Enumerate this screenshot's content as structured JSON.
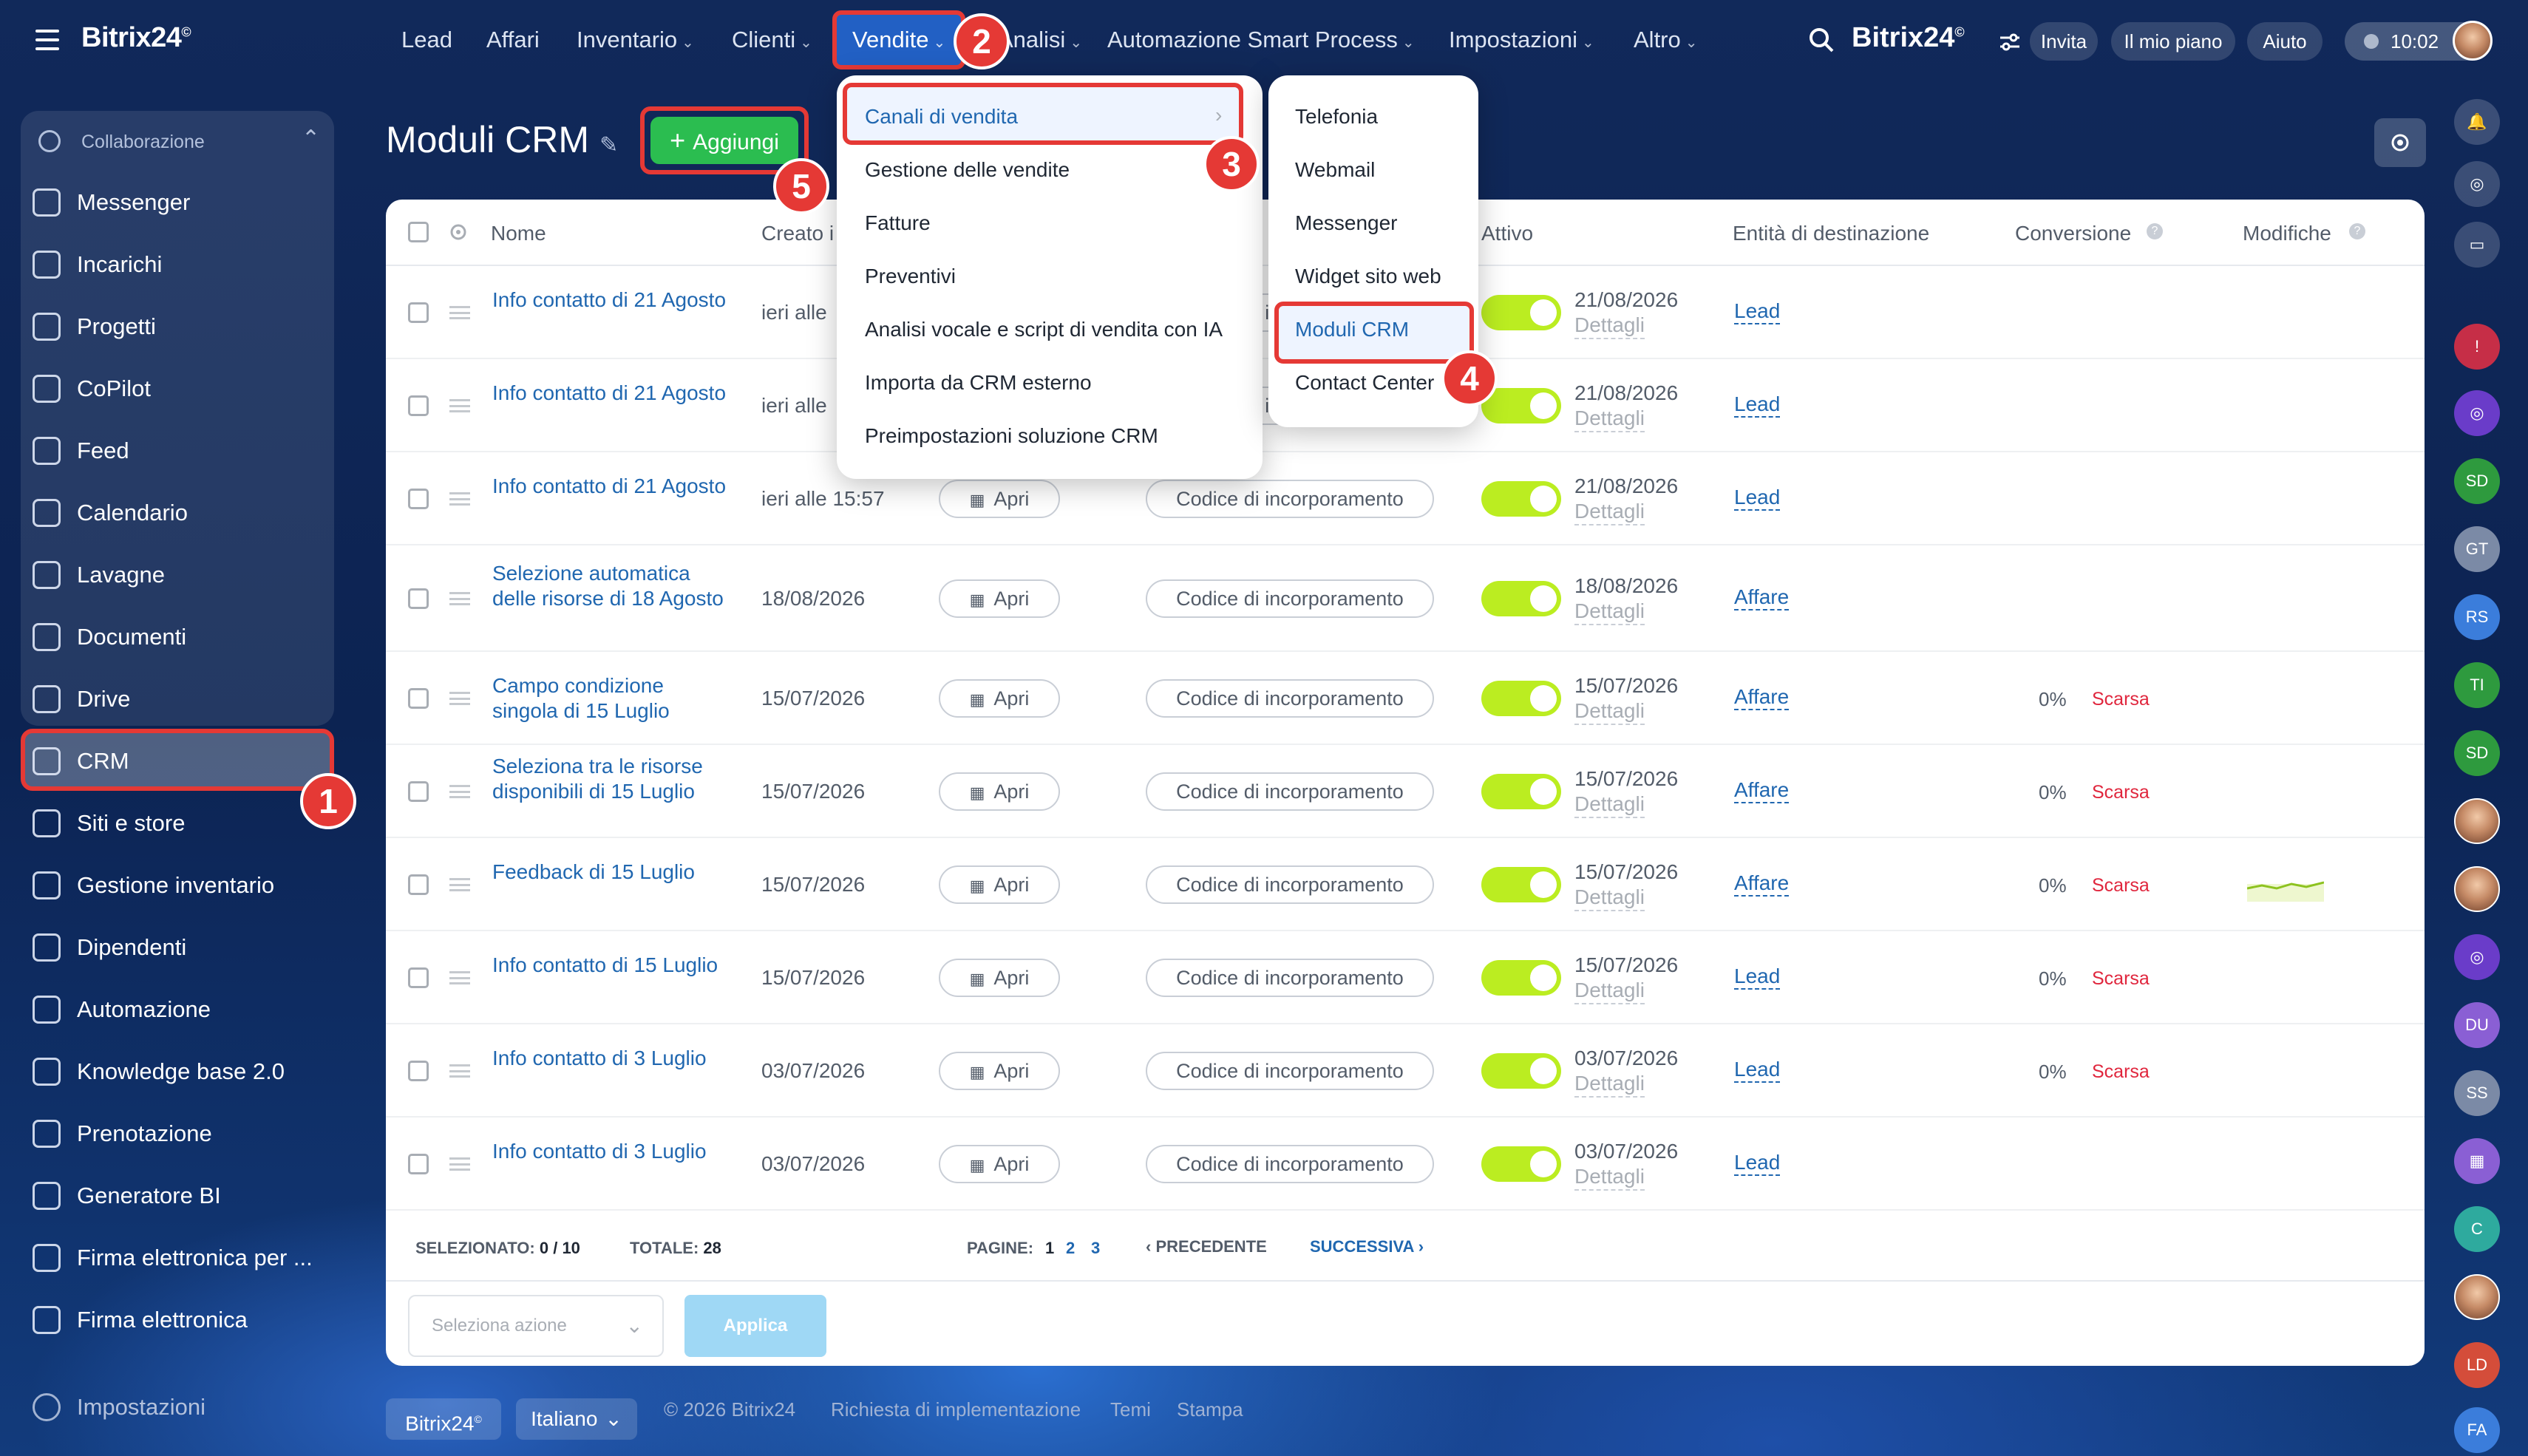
{
  "app": {
    "logo": "Bitrix24",
    "logo_mark": "©",
    "time": "10:02"
  },
  "topnav": {
    "items": [
      "Lead",
      "Affari",
      "Inventario",
      "Clienti",
      "Vendite",
      "Analisi",
      "Automazione Smart Process",
      "Impostazioni",
      "Altro"
    ],
    "active": "Vendite",
    "right": {
      "logo": "Bitrix24",
      "invite": "Invita",
      "plan": "Il mio piano",
      "help": "Aiuto"
    }
  },
  "sidebar": {
    "section": "Collaborazione",
    "items": [
      "Messenger",
      "Incarichi",
      "Progetti",
      "CoPilot",
      "Feed",
      "Calendario",
      "Lavagne",
      "Documenti",
      "Drive",
      "CRM",
      "Siti e store",
      "Gestione inventario",
      "Dipendenti",
      "Automazione",
      "Knowledge base 2.0",
      "Prenotazione",
      "Generatore BI",
      "Firma elettronica per ...",
      "Firma elettronica"
    ],
    "active": "CRM",
    "settings": "Impostazioni"
  },
  "page": {
    "title": "Moduli CRM",
    "add_label": "Aggiungi"
  },
  "table": {
    "headers": {
      "name": "Nome",
      "created": "Creato i",
      "active": "Attivo",
      "entity": "Entità di destinazione",
      "conversion": "Conversione",
      "changes": "Modifiche"
    },
    "open_label": "Apri",
    "embed_label": "Codice di incorporamento",
    "details_label": "Dettagli",
    "rows": [
      {
        "name": "Info contatto di 21 Agosto",
        "created": "ieri alle",
        "date": "21/08/2026",
        "entity": "Lead",
        "conv": "",
        "rating": ""
      },
      {
        "name": "Info contatto di 21 Agosto",
        "created": "ieri alle",
        "date": "21/08/2026",
        "entity": "Lead",
        "conv": "",
        "rating": ""
      },
      {
        "name": "Info contatto di 21 Agosto",
        "created": "ieri alle 15:57",
        "date": "21/08/2026",
        "entity": "Lead",
        "conv": "",
        "rating": ""
      },
      {
        "name": "Selezione automatica delle risorse di 18 Agosto",
        "created": "18/08/2026",
        "date": "18/08/2026",
        "entity": "Affare",
        "conv": "",
        "rating": ""
      },
      {
        "name": "Campo condizione singola di 15 Luglio",
        "created": "15/07/2026",
        "date": "15/07/2026",
        "entity": "Affare",
        "conv": "0%",
        "rating": "Scarsa"
      },
      {
        "name": "Seleziona tra le risorse disponibili di 15 Luglio",
        "created": "15/07/2026",
        "date": "15/07/2026",
        "entity": "Affare",
        "conv": "0%",
        "rating": "Scarsa"
      },
      {
        "name": "Feedback di 15 Luglio",
        "created": "15/07/2026",
        "date": "15/07/2026",
        "entity": "Affare",
        "conv": "0%",
        "rating": "Scarsa"
      },
      {
        "name": "Info contatto di 15 Luglio",
        "created": "15/07/2026",
        "date": "15/07/2026",
        "entity": "Lead",
        "conv": "0%",
        "rating": "Scarsa"
      },
      {
        "name": "Info contatto di 3 Luglio",
        "created": "03/07/2026",
        "date": "03/07/2026",
        "entity": "Lead",
        "conv": "0%",
        "rating": "Scarsa"
      },
      {
        "name": "Info contatto di 3 Luglio",
        "created": "03/07/2026",
        "date": "03/07/2026",
        "entity": "Lead",
        "conv": "",
        "rating": ""
      }
    ],
    "footer": {
      "selected_label": "Selezionato:",
      "selected": "0 / 10",
      "total_label": "Totale:",
      "total": "28",
      "pages_label": "Pagine:",
      "pages": [
        "1",
        "2",
        "3"
      ],
      "prev": "Precedente",
      "next": "Successiva"
    },
    "action_select": "Seleziona azione",
    "apply": "Applica"
  },
  "menu_vendite": [
    "Canali di vendita",
    "Gestione delle vendite",
    "Fatture",
    "Preventivi",
    "Analisi vocale e script di vendita con IA",
    "Importa da CRM esterno",
    "Preimpostazioni soluzione CRM"
  ],
  "submenu_canali": [
    "Telefonia",
    "Webmail",
    "Messenger",
    "Widget sito web",
    "Moduli CRM",
    "Contact Center"
  ],
  "steps": [
    "1",
    "2",
    "3",
    "4",
    "5"
  ],
  "right_bar": [
    "SD",
    "GT",
    "RS",
    "TI",
    "SD",
    "DU",
    "SS",
    "C",
    "LD",
    "FA"
  ],
  "bottom": {
    "logo": "Bitrix24",
    "lang": "Italiano",
    "copyright": "© 2026 Bitrix24",
    "impl": "Richiesta di implementazione",
    "themes": "Temi",
    "print": "Stampa"
  },
  "colors": {
    "accent": "#2067b0",
    "brand_blue": "#2260c4",
    "green": "#2bbd50",
    "toggle": "#bbed21",
    "highlight": "#e53935"
  }
}
